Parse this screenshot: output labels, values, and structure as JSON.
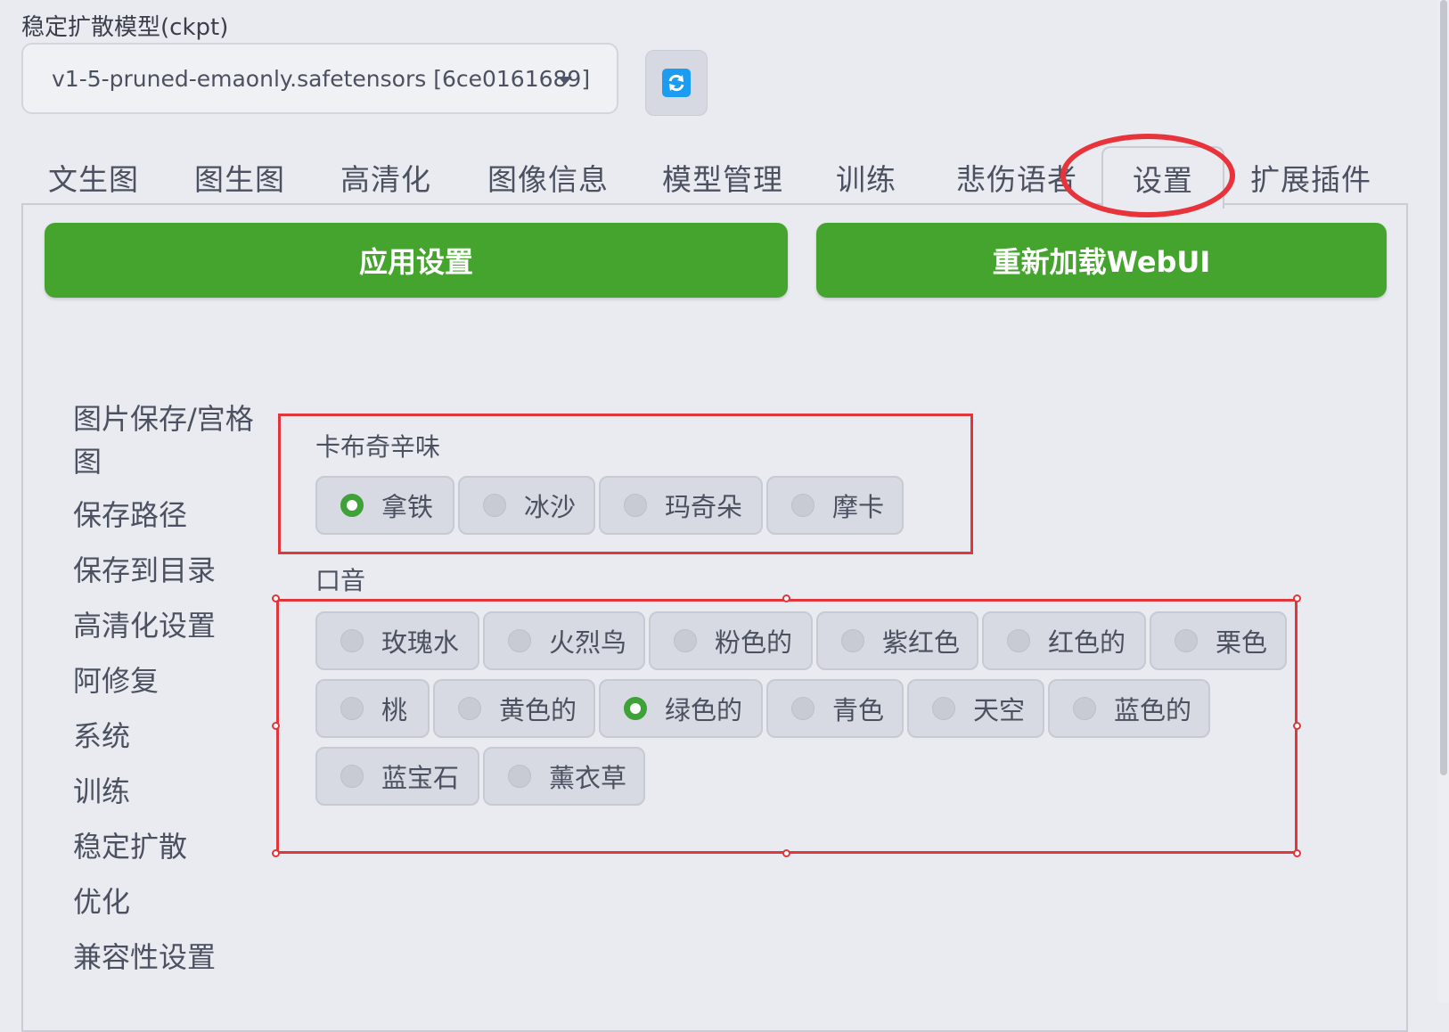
{
  "model": {
    "label": "稳定扩散模型(ckpt)",
    "selected": "v1-5-pruned-emaonly.safetensors [6ce0161689]"
  },
  "tabs": [
    {
      "label": "文生图"
    },
    {
      "label": "图生图"
    },
    {
      "label": "高清化"
    },
    {
      "label": "图像信息"
    },
    {
      "label": "模型管理"
    },
    {
      "label": "训练"
    },
    {
      "label": "悲伤语者"
    },
    {
      "label": "设置"
    },
    {
      "label": "扩展插件"
    }
  ],
  "active_tab": "设置",
  "actions": {
    "apply_label": "应用设置",
    "reload_label": "重新加载WebUI"
  },
  "categories": [
    "图片保存/宫格图",
    "保存路径",
    "保存到目录",
    "高清化设置",
    "阿修复",
    "系统",
    "训练",
    "稳定扩散",
    "优化",
    "兼容性设置"
  ],
  "groups": {
    "flavor": {
      "label": "卡布奇辛味",
      "options": [
        "拿铁",
        "冰沙",
        "玛奇朵",
        "摩卡"
      ],
      "selected": "拿铁"
    },
    "accent": {
      "label": "口音",
      "options": [
        "玫瑰水",
        "火烈鸟",
        "粉色的",
        "紫红色",
        "红色的",
        "栗色",
        "桃",
        "黄色的",
        "绿色的",
        "青色",
        "天空",
        "蓝色的",
        "蓝宝石",
        "薰衣草"
      ],
      "selected": "绿色的"
    }
  },
  "colors": {
    "accent_green": "#45a42e",
    "annotation_red": "#e1363c",
    "refresh_blue": "#1c9cf0"
  }
}
